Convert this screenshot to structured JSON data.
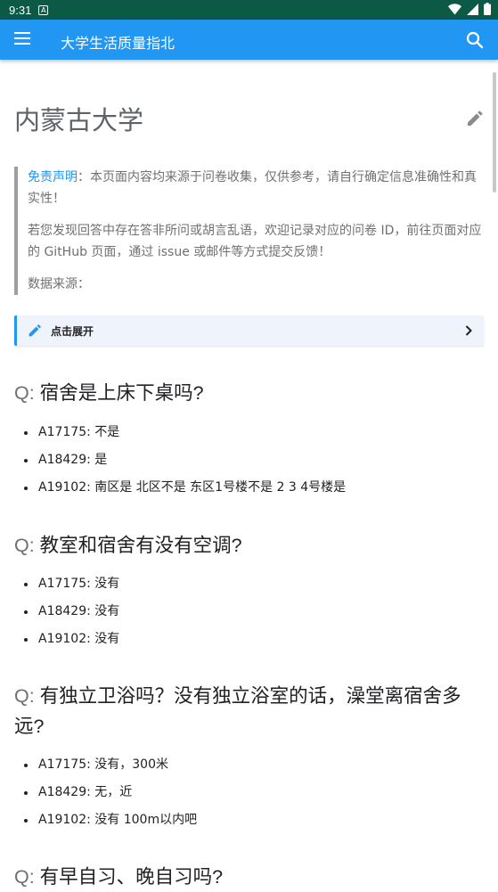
{
  "status_bar": {
    "time": "9:31",
    "notification_letter": "A"
  },
  "app_bar": {
    "title": "大学生活质量指北",
    "menu_icon": "menu-icon",
    "search_icon": "search-icon"
  },
  "page": {
    "heading": "内蒙古大学",
    "notice": {
      "disclaimer_label": "免责声明",
      "disclaimer_text": "：本页面内容均来源于问卷收集，仅供参考，请自行确定信息准确性和真实性！",
      "feedback_text": "若您发现回答中存在答非所问或胡言乱语，欢迎记录对应的问卷 ID，前往页面对应的 GitHub 页面，通过 issue 或邮件等方式提交反馈！",
      "source_text": "数据来源："
    },
    "expander_label": "点击展开",
    "q_prefix": "Q: ",
    "questions": [
      {
        "text": "宿舍是上床下桌吗?",
        "answers": [
          "A17175: 不是",
          "A18429: 是",
          "A19102: 南区是 北区不是 东区1号楼不是 2 3 4号楼是"
        ]
      },
      {
        "text": "教室和宿舍有没有空调?",
        "answers": [
          "A17175: 没有",
          "A18429: 没有",
          "A19102: 没有"
        ]
      },
      {
        "text": "有独立卫浴吗？没有独立浴室的话，澡堂离宿舍多远?",
        "answers": [
          "A17175: 没有，300米",
          "A18429: 无，近",
          "A19102: 没有 100m以内吧"
        ]
      },
      {
        "text": "有早自习、晚自习吗?",
        "answers": []
      }
    ]
  },
  "colors": {
    "status_bar": "#0c5a46",
    "app_bar": "#2196f3",
    "accent": "#2196f3",
    "expander_bg": "#eef3fc"
  }
}
